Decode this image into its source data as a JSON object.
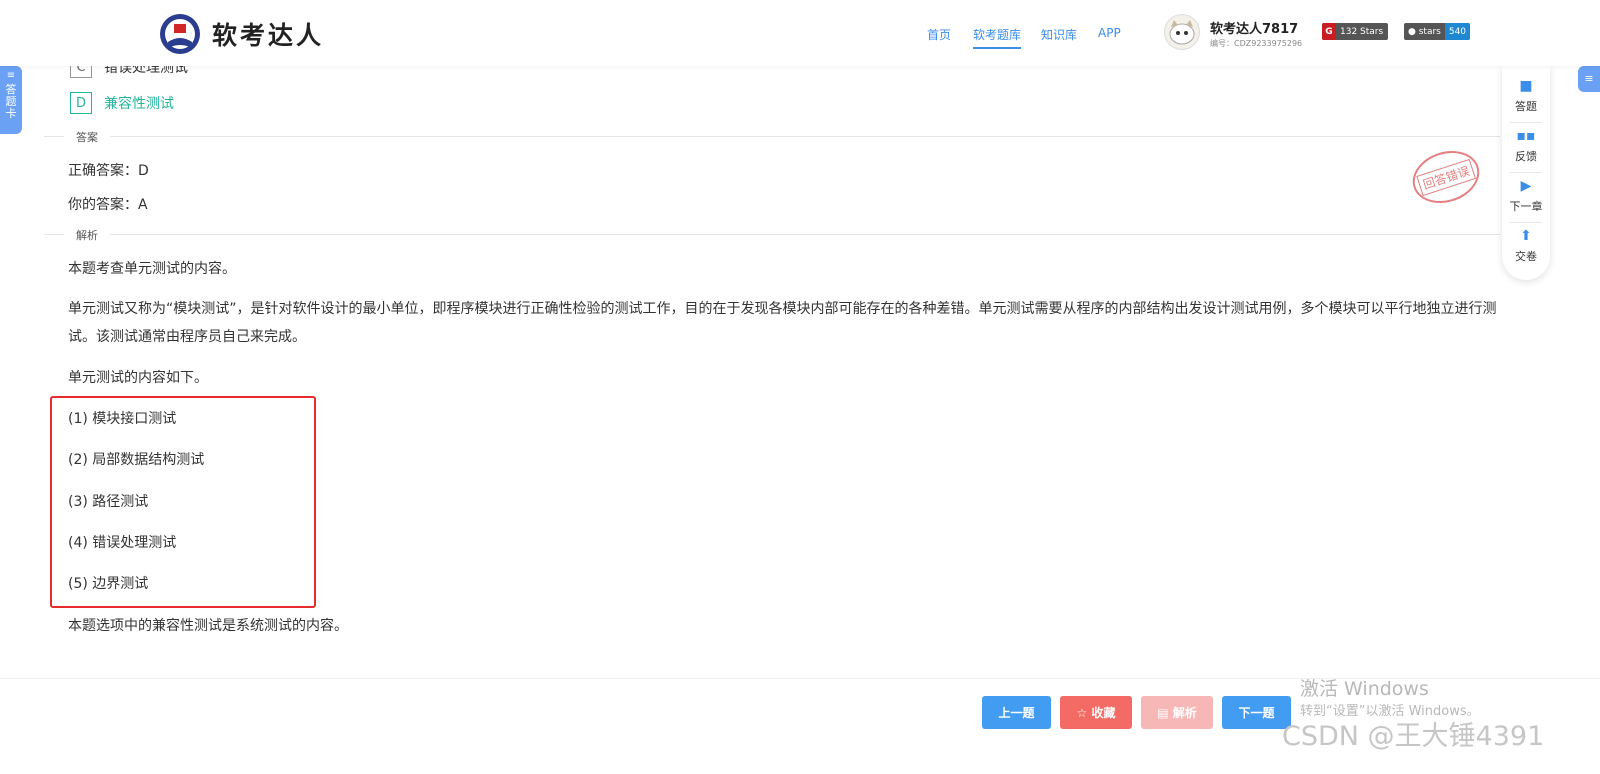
{
  "header": {
    "logo_text": "软考达人",
    "nav": [
      "首页",
      "软考题库",
      "知识库",
      "APP"
    ],
    "active_nav": "软考题库",
    "user_name": "软考达人7817",
    "user_code": "编号：CDZ9233975296",
    "badge_gitee": "132 Stars",
    "badge_github_label": "stars",
    "badge_github_count": "540"
  },
  "side": {
    "left_tab": "答题卡",
    "right_tab": "≡"
  },
  "question": {
    "option_c_letter": "C",
    "option_c_text": "错误处理测试",
    "option_d_letter": "D",
    "option_d_text": "兼容性测试"
  },
  "answer": {
    "section_label": "答案",
    "correct": "正确答案：D",
    "yours": "你的答案：A",
    "stamp": "回答错误"
  },
  "analysis": {
    "section_label": "解析",
    "p1": "本题考查单元测试的内容。",
    "p2": "单元测试又称为“模块测试”，是针对软件设计的最小单位，即程序模块进行正确性检验的测试工作，目的在于发现各模块内部可能存在的各种差错。单元测试需要从程序的内部结构出发设计测试用例，多个模块可以平行地独立进行测试。该测试通常由程序员自己来完成。",
    "p3": "单元测试的内容如下。",
    "items": [
      "(1) 模块接口测试",
      "(2) 局部数据结构测试",
      "(3) 路径测试",
      "(4) 错误处理测试",
      "(5) 边界测试"
    ],
    "p4": "本题选项中的兼容性测试是系统测试的内容。"
  },
  "toolbar": [
    "答题",
    "反馈",
    "下一章",
    "交卷"
  ],
  "buttons": {
    "prev": "上一题",
    "favorite": "☆ 收藏",
    "analysis": "▤ 解析",
    "next": "下一题"
  },
  "watermark": {
    "line1": "激活 Windows",
    "line2": "转到“设置”以激活 Windows。",
    "line3": "CSDN @王大锤4391"
  },
  "colors": {
    "primary": "#419cf2",
    "correct": "#25b59b",
    "danger": "#e62b2b"
  }
}
